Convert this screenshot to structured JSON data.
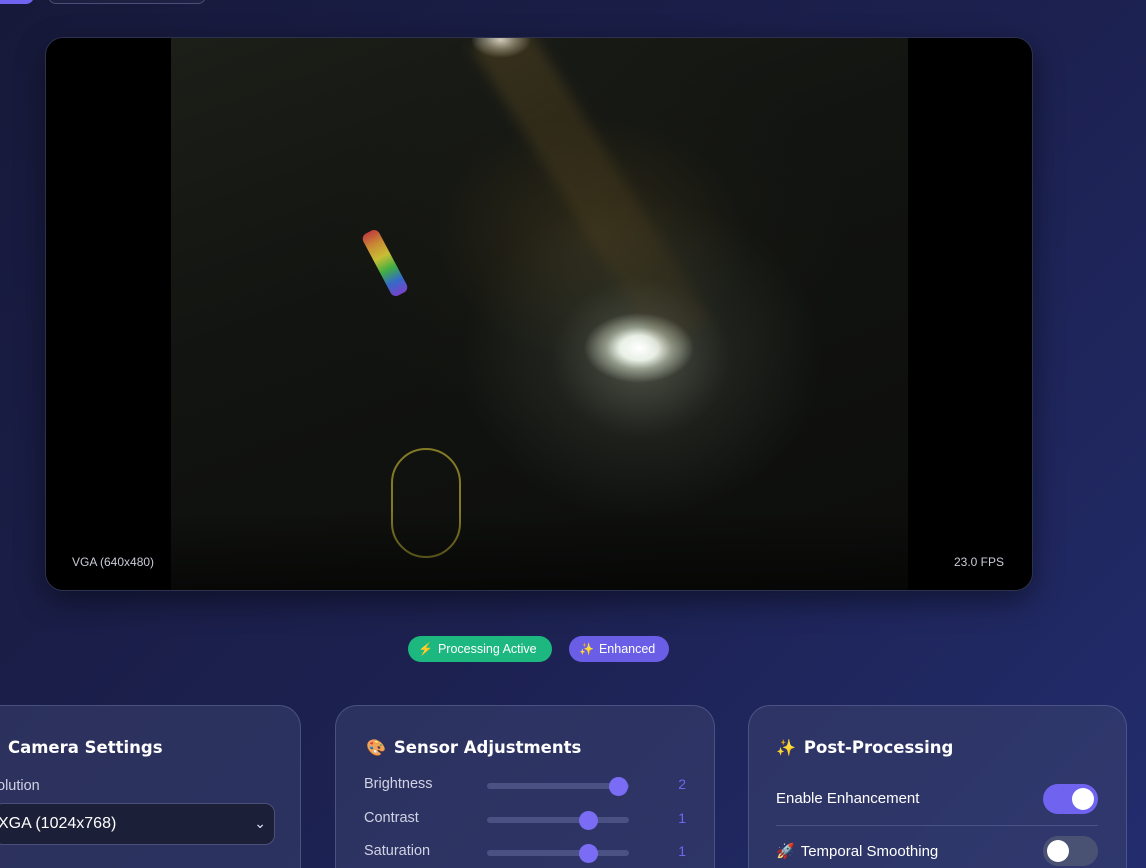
{
  "video": {
    "resolution_label": "VGA (640x480)",
    "fps_label": "23.0 FPS"
  },
  "badges": {
    "processing": {
      "icon": "⚡",
      "label": "Processing Active",
      "color": "#1db87f"
    },
    "enhanced": {
      "icon": "✨",
      "label": "Enhanced",
      "color": "#6a5ee6"
    }
  },
  "camera_settings": {
    "title": "Camera Settings",
    "resolution_label": "olution",
    "resolution_value": "XGA (1024x768)"
  },
  "sensor_adjustments": {
    "icon": "🎨",
    "title": "Sensor Adjustments",
    "sliders": [
      {
        "label": "Brightness",
        "value": "2",
        "level": 0.92
      },
      {
        "label": "Contrast",
        "value": "1",
        "level": 0.71
      },
      {
        "label": "Saturation",
        "value": "1",
        "level": 0.71
      }
    ]
  },
  "post_processing": {
    "icon": "✨",
    "title": "Post-Processing",
    "toggles": [
      {
        "label": "Enable Enhancement",
        "icon": "",
        "on": true
      },
      {
        "label": "Temporal Smoothing",
        "icon": "🚀",
        "on": false
      }
    ]
  },
  "colors": {
    "accent": "#6f63f0",
    "success": "#1db87f"
  }
}
